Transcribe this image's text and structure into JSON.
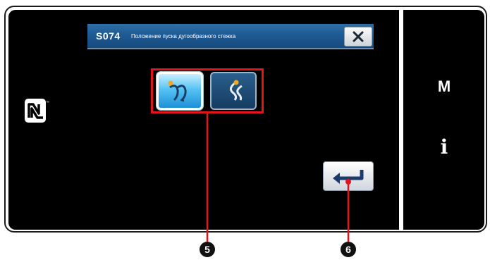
{
  "dialog": {
    "code": "S074",
    "title": "Положение пуска дугообразного стежка",
    "close_icon": "close-icon"
  },
  "options": [
    {
      "icon": "arc-stitch-start-right-icon",
      "selected": true
    },
    {
      "icon": "arc-stitch-start-left-icon",
      "selected": false
    }
  ],
  "enter_icon": "enter-icon",
  "side_panel": {
    "mode_label": "M",
    "info_label": "i"
  },
  "nfc_icon": "nfc-icon",
  "callouts": {
    "selection": "5",
    "enter": "6"
  },
  "colors": {
    "title_bar": "#1f5c96",
    "selected_button": "#56c3f3",
    "highlight_frame": "#e3141c",
    "screen_bg": "#000000"
  }
}
